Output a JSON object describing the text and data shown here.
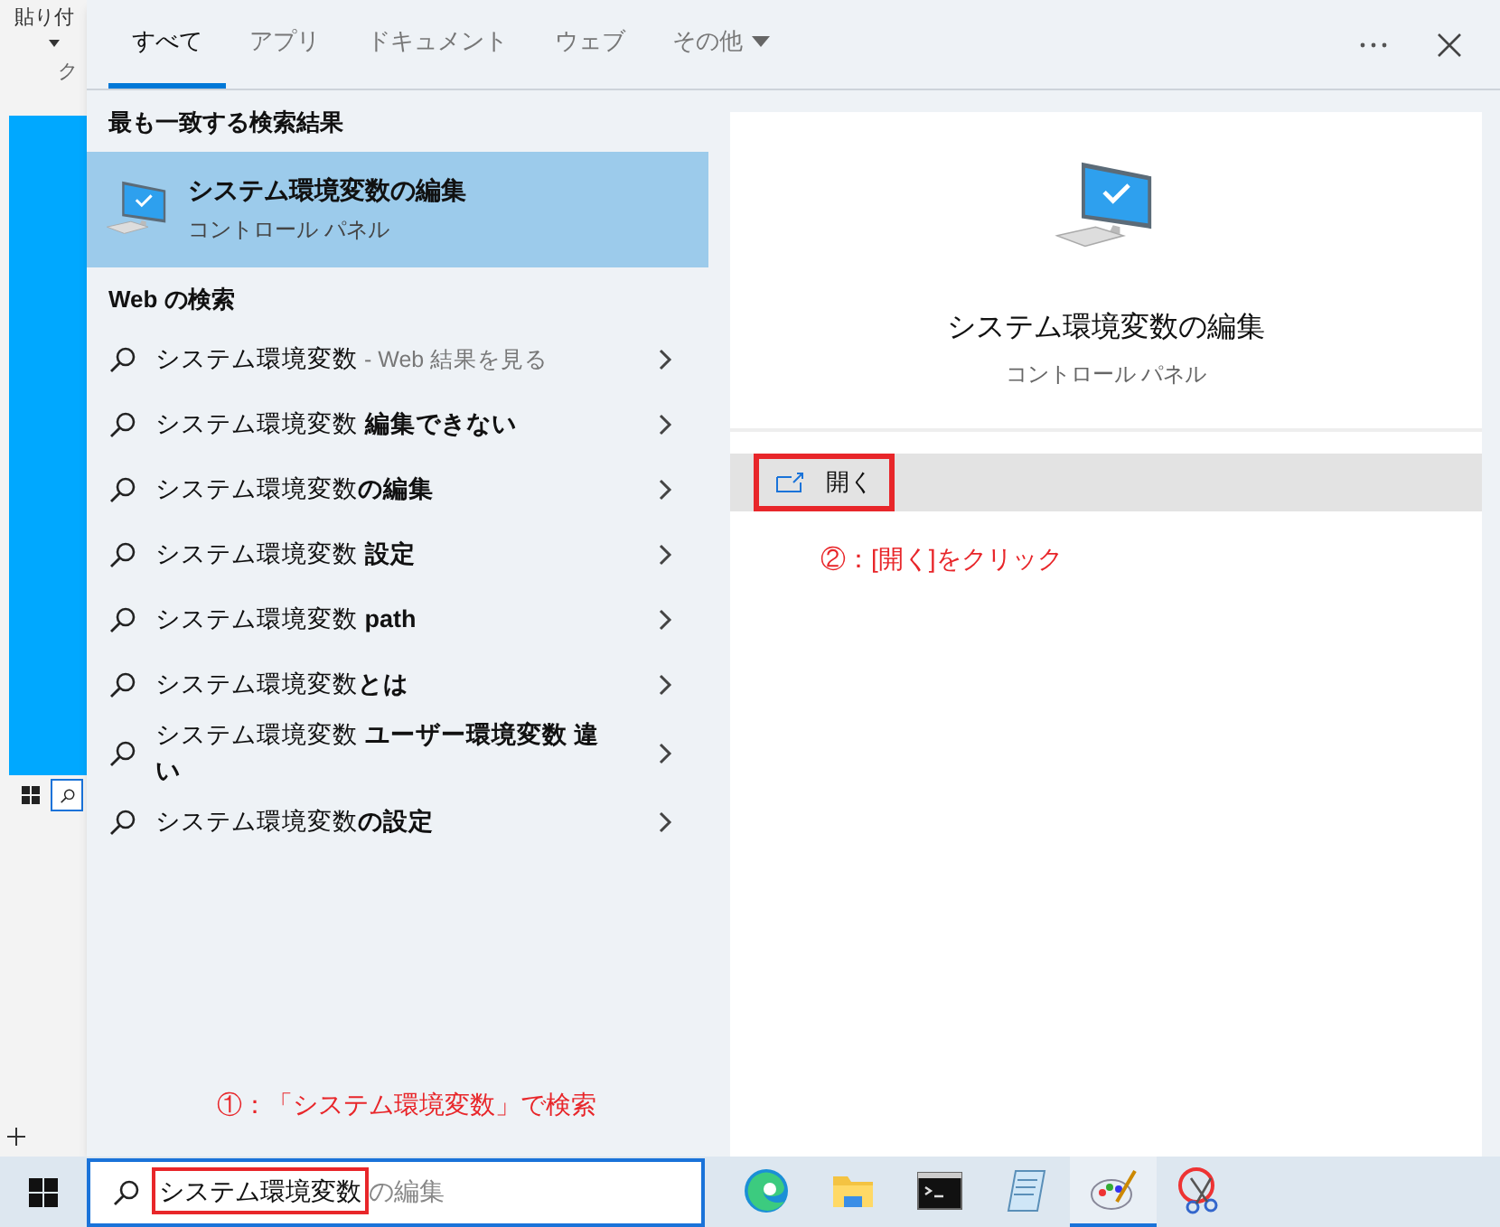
{
  "background_window": {
    "ribbon_label": "貼り付",
    "group_label": "ク"
  },
  "tabs": [
    {
      "label": "すべて",
      "selected": true
    },
    {
      "label": "アプリ",
      "selected": false
    },
    {
      "label": "ドキュメント",
      "selected": false
    },
    {
      "label": "ウェブ",
      "selected": false
    },
    {
      "label": "その他",
      "selected": false,
      "kind": "dropdown"
    }
  ],
  "best_match": {
    "heading": "最も一致する検索結果",
    "title": "システム環境変数の編集",
    "subtitle": "コントロール パネル",
    "selected": true
  },
  "web_search": {
    "heading": "Web の検索",
    "items": [
      {
        "text": "システム環境変数",
        "suffix": "- Web 結果を見る"
      },
      {
        "text": "システム環境変数 **編集できない**"
      },
      {
        "text": "システム環境変数**の編集**"
      },
      {
        "text": "システム環境変数 **設定**"
      },
      {
        "text": "システム環境変数 **path**"
      },
      {
        "text": "システム環境変数**とは**"
      },
      {
        "text": "システム環境変数 **ユーザー環境変数 違い**"
      },
      {
        "text": "システム環境変数**の設定**"
      }
    ]
  },
  "annotation_1": "①：「システム環境変数」で検索",
  "preview": {
    "title": "システム環境変数の編集",
    "subtitle": "コントロール パネル",
    "action": "開く",
    "annotation": "②：[開く]をクリック"
  },
  "search_box": {
    "value": "システム環境変数",
    "suggestion": "の編集"
  },
  "taskbar_apps": [
    {
      "kind": "edge",
      "active": false
    },
    {
      "kind": "folder",
      "active": false
    },
    {
      "kind": "terminal",
      "active": false
    },
    {
      "kind": "notepad",
      "active": false
    },
    {
      "kind": "paint",
      "active": true
    },
    {
      "kind": "snip",
      "active": false
    }
  ]
}
